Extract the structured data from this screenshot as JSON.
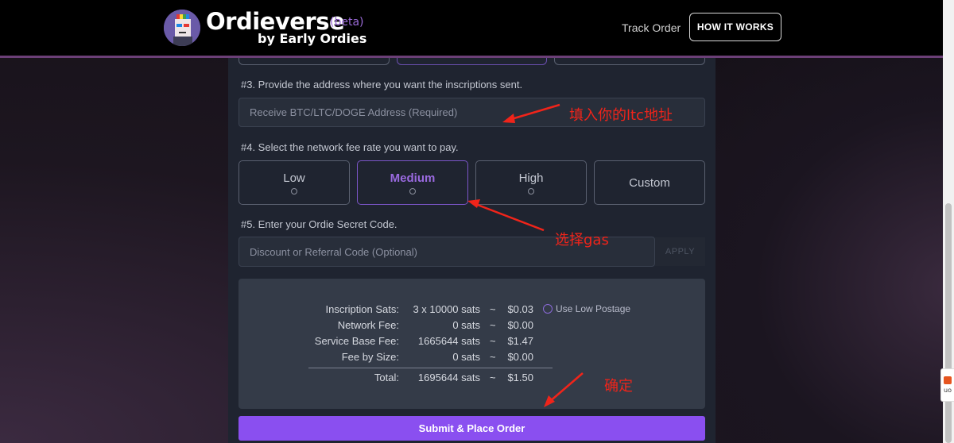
{
  "header": {
    "brand": "Ordieverse",
    "beta": "(beta)",
    "byline": "by Early Ordies",
    "nav_track": "Track Order",
    "nav_how": "HOW IT WORKS"
  },
  "step3": {
    "label": "#3. Provide the address where you want the inscriptions sent.",
    "placeholder": "Receive BTC/LTC/DOGE Address (Required)"
  },
  "step4": {
    "label": "#4. Select the network fee rate you want to pay.",
    "options": [
      {
        "label": "Low",
        "selected": false
      },
      {
        "label": "Medium",
        "selected": true
      },
      {
        "label": "High",
        "selected": false
      },
      {
        "label": "Custom",
        "selected": false
      }
    ]
  },
  "step5": {
    "label": "#5. Enter your Ordie Secret Code.",
    "placeholder": "Discount or Referral Code (Optional)",
    "apply": "APPLY"
  },
  "summary": {
    "rows": [
      {
        "label": "Inscription Sats:",
        "sats": "3 x 10000 sats",
        "tilde": "~",
        "usd": "$0.03"
      },
      {
        "label": "Network Fee:",
        "sats": "0 sats",
        "tilde": "~",
        "usd": "$0.00"
      },
      {
        "label": "Service Base Fee:",
        "sats": "1665644 sats",
        "tilde": "~",
        "usd": "$1.47"
      },
      {
        "label": "Fee by Size:",
        "sats": "0 sats",
        "tilde": "~",
        "usd": "$0.00"
      }
    ],
    "total": {
      "label": "Total:",
      "sats": "1695644 sats",
      "tilde": "~",
      "usd": "$1.50"
    },
    "low_postage": "Use Low Postage"
  },
  "submit_label": "Submit & Place Order",
  "annotations": {
    "address": "填入你的ltc地址",
    "gas": "选择gas",
    "confirm": "确定"
  },
  "side_widget": "uo",
  "colors": {
    "accent": "#8a4ff0",
    "annotation_red": "#f0241a",
    "selected_border": "#7b55c8"
  }
}
